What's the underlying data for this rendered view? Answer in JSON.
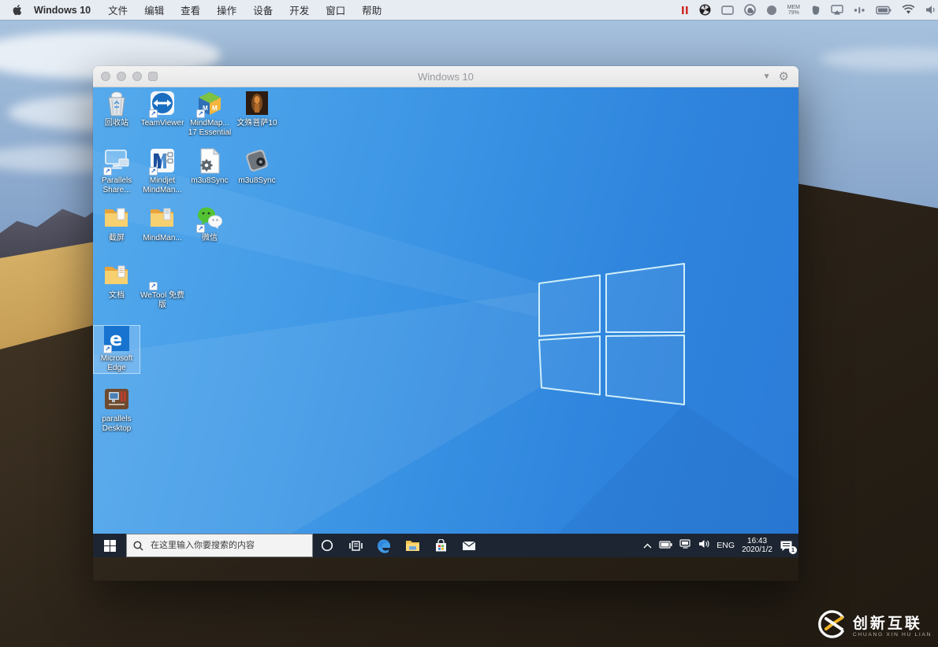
{
  "menubar": {
    "app_name": "Windows 10",
    "menus": [
      {
        "label": "文件"
      },
      {
        "label": "编辑"
      },
      {
        "label": "查看"
      },
      {
        "label": "操作"
      },
      {
        "label": "设备"
      },
      {
        "label": "开发"
      },
      {
        "label": "窗口"
      },
      {
        "label": "帮助"
      }
    ],
    "mem_label": "MEM",
    "mem_value": "79%"
  },
  "window": {
    "title": "Windows 10"
  },
  "desktop_icons": [
    {
      "label": "回收站",
      "icon": "recycle-bin"
    },
    {
      "label": "TeamViewer",
      "icon": "teamviewer"
    },
    {
      "label": "MindMap... 17 Essential",
      "icon": "mindmap-cube"
    },
    {
      "label": "文殊菩萨10",
      "icon": "photo"
    },
    {
      "label": "Parallels Share...",
      "icon": "shared-monitor"
    },
    {
      "label": "Mindjet MindMan...",
      "icon": "mindjet"
    },
    {
      "label": "m3u8Sync",
      "icon": "document-gear"
    },
    {
      "label": "m3u8Sync",
      "icon": "dark-package"
    },
    {
      "label": "截屏",
      "icon": "folder"
    },
    {
      "label": "MindMan...",
      "icon": "folder"
    },
    {
      "label": "微信",
      "icon": "wechat"
    },
    {
      "label": "文档",
      "icon": "folder"
    },
    {
      "label": "WeTool 免费版",
      "icon": "wetool"
    },
    {
      "label": "Microsoft Edge",
      "icon": "edge",
      "selected": true
    },
    {
      "label": "parallels Desktop",
      "icon": "parallels-desktop"
    }
  ],
  "taskbar": {
    "search_placeholder": "在这里输入你要搜索的内容",
    "language": "ENG",
    "time": "16:43",
    "date": "2020/1/2",
    "notification_count": "1"
  },
  "watermark": {
    "title": "创新互联",
    "subtitle": "CHUANG XIN HU LIAN"
  }
}
